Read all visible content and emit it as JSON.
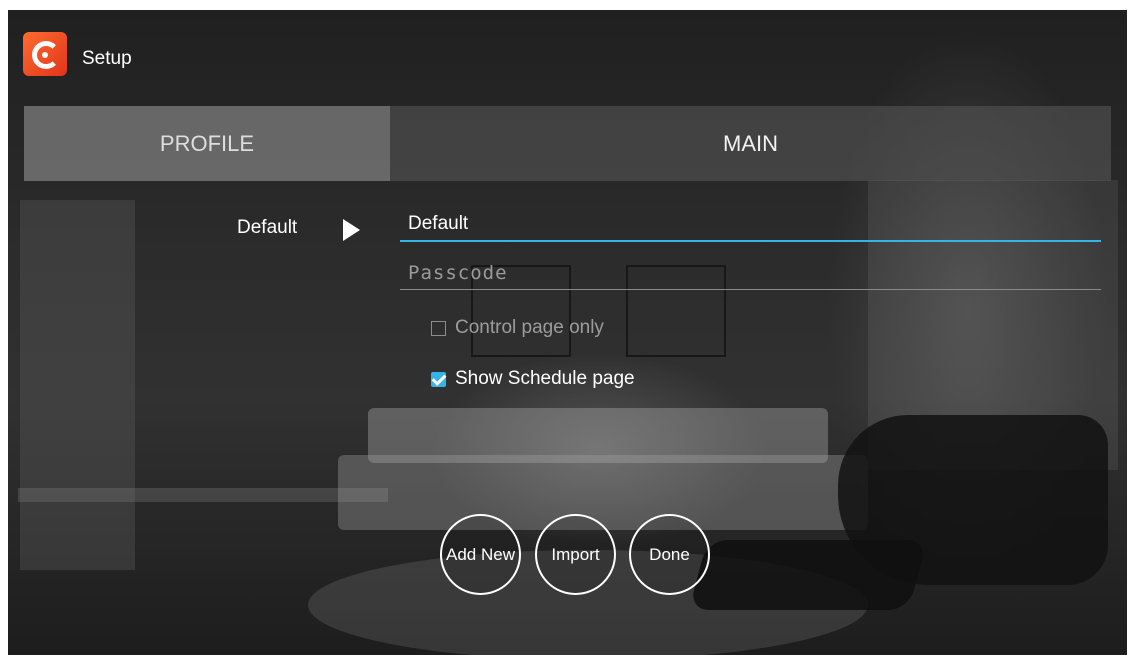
{
  "app": {
    "title": "Setup",
    "icon": "app-logo-icon",
    "brand_color": "#f0522a"
  },
  "tabs": [
    {
      "label": "PROFILE",
      "selected": false
    },
    {
      "label": "MAIN",
      "selected": true
    }
  ],
  "profile": {
    "name": "Default",
    "arrow_icon": "play-arrow-icon"
  },
  "form": {
    "name_value": "Default",
    "passcode_placeholder": "Passcode",
    "control_page_only": {
      "label": "Control page only",
      "checked": false,
      "enabled": false
    },
    "show_schedule_page": {
      "label": "Show Schedule page",
      "checked": true
    }
  },
  "buttons": {
    "add_new": "Add New",
    "import": "Import",
    "done": "Done"
  },
  "colors": {
    "accent": "#33b5e5"
  }
}
